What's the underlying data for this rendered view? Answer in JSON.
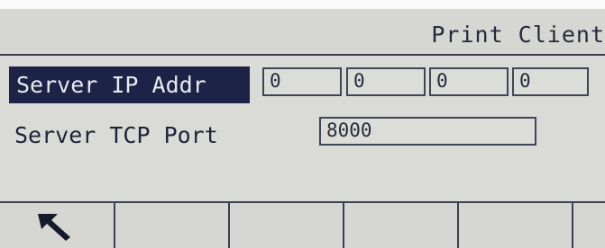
{
  "header": {
    "title": "Print Client"
  },
  "server_ip": {
    "label": "Server IP Addr",
    "octets": [
      "0",
      "0",
      "0",
      "0"
    ]
  },
  "server_tcp_port": {
    "label": "Server TCP Port",
    "value": "8000"
  },
  "softkeys": [
    {
      "icon": "back-arrow-icon"
    },
    {
      "icon": ""
    },
    {
      "icon": ""
    },
    {
      "icon": ""
    },
    {
      "icon": ""
    },
    {
      "icon": ""
    }
  ]
}
